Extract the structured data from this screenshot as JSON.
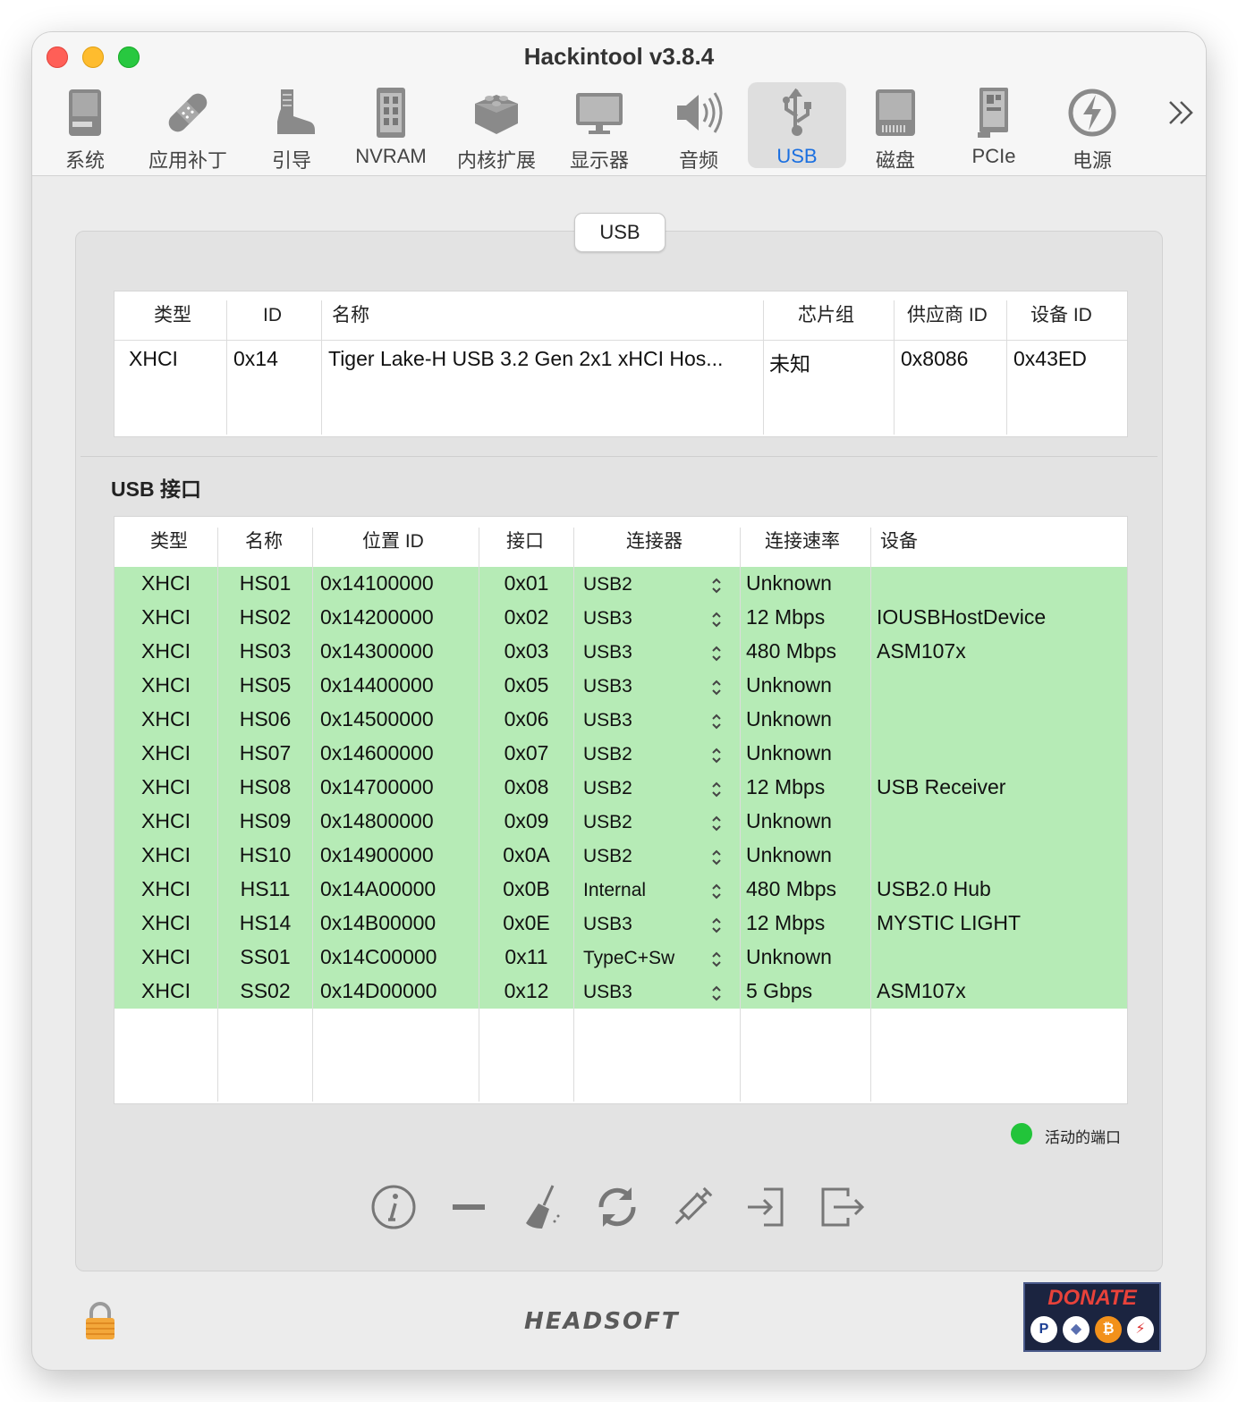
{
  "window": {
    "title": "Hackintool v3.8.4"
  },
  "toolbar": {
    "items": [
      {
        "label": "系统",
        "icon": "system-icon"
      },
      {
        "label": "应用补丁",
        "icon": "patch-icon"
      },
      {
        "label": "引导",
        "icon": "boot-icon"
      },
      {
        "label": "NVRAM",
        "icon": "nvram-icon"
      },
      {
        "label": "内核扩展",
        "icon": "kext-icon"
      },
      {
        "label": "显示器",
        "icon": "display-icon"
      },
      {
        "label": "音频",
        "icon": "audio-icon"
      },
      {
        "label": "USB",
        "icon": "usb-icon",
        "selected": true
      },
      {
        "label": "磁盘",
        "icon": "disk-icon"
      },
      {
        "label": "PCIe",
        "icon": "pcie-icon"
      },
      {
        "label": "电源",
        "icon": "power-icon"
      }
    ],
    "overflow_icon": "chevron-double-right-icon"
  },
  "segment": {
    "label": "USB"
  },
  "controllers": {
    "columns": [
      "类型",
      "ID",
      "名称",
      "芯片组",
      "供应商 ID",
      "设备 ID"
    ],
    "rows": [
      [
        "XHCI",
        "0x14",
        "Tiger Lake-H USB 3.2 Gen 2x1 xHCI Hos...",
        "未知",
        "0x8086",
        "0x43ED"
      ]
    ]
  },
  "ports": {
    "title": "USB 接口",
    "columns": [
      "类型",
      "名称",
      "位置 ID",
      "接口",
      "连接器",
      "连接速率",
      "设备"
    ],
    "rows": [
      [
        "XHCI",
        "HS01",
        "0x14100000",
        "0x01",
        "USB2",
        "Unknown",
        ""
      ],
      [
        "XHCI",
        "HS02",
        "0x14200000",
        "0x02",
        "USB3",
        "12 Mbps",
        "IOUSBHostDevice"
      ],
      [
        "XHCI",
        "HS03",
        "0x14300000",
        "0x03",
        "USB3",
        "480 Mbps",
        "ASM107x"
      ],
      [
        "XHCI",
        "HS05",
        "0x14400000",
        "0x05",
        "USB3",
        "Unknown",
        ""
      ],
      [
        "XHCI",
        "HS06",
        "0x14500000",
        "0x06",
        "USB3",
        "Unknown",
        ""
      ],
      [
        "XHCI",
        "HS07",
        "0x14600000",
        "0x07",
        "USB2",
        "Unknown",
        ""
      ],
      [
        "XHCI",
        "HS08",
        "0x14700000",
        "0x08",
        "USB2",
        "12 Mbps",
        "USB Receiver"
      ],
      [
        "XHCI",
        "HS09",
        "0x14800000",
        "0x09",
        "USB2",
        "Unknown",
        ""
      ],
      [
        "XHCI",
        "HS10",
        "0x14900000",
        "0x0A",
        "USB2",
        "Unknown",
        ""
      ],
      [
        "XHCI",
        "HS11",
        "0x14A00000",
        "0x0B",
        "Internal",
        "480 Mbps",
        "USB2.0 Hub"
      ],
      [
        "XHCI",
        "HS14",
        "0x14B00000",
        "0x0E",
        "USB3",
        "12 Mbps",
        "MYSTIC LIGHT"
      ],
      [
        "XHCI",
        "SS01",
        "0x14C00000",
        "0x11",
        "TypeC+Sw",
        "Unknown",
        ""
      ],
      [
        "XHCI",
        "SS02",
        "0x14D00000",
        "0x12",
        "USB3",
        "5 Gbps",
        "ASM107x"
      ]
    ],
    "active_color": "#b6ebb6"
  },
  "legend": {
    "label": "活动的端口",
    "color": "#22c43a"
  },
  "actions": [
    "info-icon",
    "remove-icon",
    "clear-icon",
    "refresh-icon",
    "inject-icon",
    "import-icon",
    "export-icon"
  ],
  "footer": {
    "brand": "HEADSOFT",
    "donate": "DONATE"
  }
}
